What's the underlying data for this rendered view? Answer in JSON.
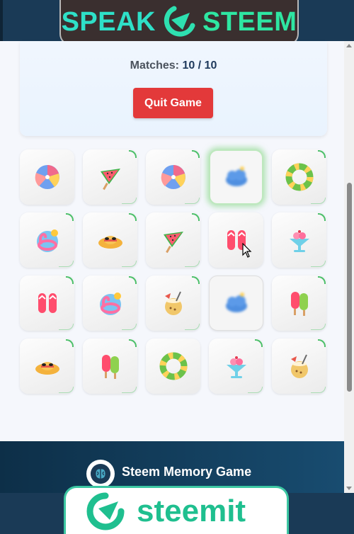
{
  "brand_top": {
    "word1": "SPEAK",
    "word2": "STEEM"
  },
  "status": {
    "matches_label": "Matches:",
    "matches_value": "10 / 10",
    "quit_label": "Quit Game"
  },
  "board": {
    "rows": [
      [
        "beach-ball",
        "watermelon",
        "beach-ball",
        "cloud-blur",
        "swim-ring"
      ],
      [
        "flamingo-float",
        "sun-hat",
        "watermelon",
        "flip-flops",
        "ice-cream-sundae"
      ],
      [
        "flip-flops",
        "flamingo-float",
        "coconut-drink",
        "cloud-blur",
        "popsicles"
      ],
      [
        "sun-hat",
        "popsicles",
        "swim-ring",
        "ice-cream-sundae",
        "coconut-drink"
      ]
    ]
  },
  "footer": {
    "title": "Steem Memory Game"
  },
  "brand_bottom": {
    "word": "steemit"
  },
  "colors": {
    "accent_red": "#e3393a",
    "match_green": "#4cbf6a",
    "navy": "#1a3a56"
  }
}
